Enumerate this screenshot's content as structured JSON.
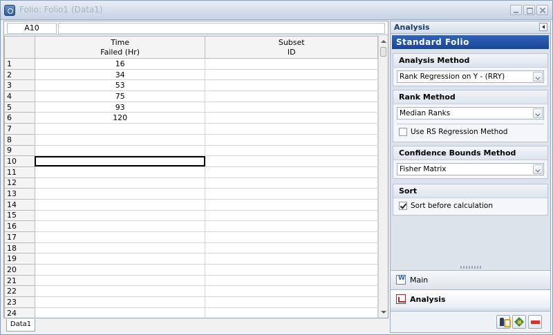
{
  "window": {
    "title": "Folio: Folio1 (Data1)"
  },
  "sheet": {
    "cell_ref": "A10",
    "formula_value": "",
    "columns": [
      {
        "label_line1": "Time",
        "label_line2": "Failed (Hr)"
      },
      {
        "label_line1": "Subset",
        "label_line2": "ID"
      }
    ],
    "rows": [
      {
        "num": "1",
        "time": "16",
        "subset": ""
      },
      {
        "num": "2",
        "time": "34",
        "subset": ""
      },
      {
        "num": "3",
        "time": "53",
        "subset": ""
      },
      {
        "num": "4",
        "time": "75",
        "subset": ""
      },
      {
        "num": "5",
        "time": "93",
        "subset": ""
      },
      {
        "num": "6",
        "time": "120",
        "subset": ""
      },
      {
        "num": "7",
        "time": "",
        "subset": ""
      },
      {
        "num": "8",
        "time": "",
        "subset": ""
      },
      {
        "num": "9",
        "time": "",
        "subset": ""
      },
      {
        "num": "10",
        "time": "",
        "subset": ""
      },
      {
        "num": "11",
        "time": "",
        "subset": ""
      },
      {
        "num": "12",
        "time": "",
        "subset": ""
      },
      {
        "num": "13",
        "time": "",
        "subset": ""
      },
      {
        "num": "14",
        "time": "",
        "subset": ""
      },
      {
        "num": "15",
        "time": "",
        "subset": ""
      },
      {
        "num": "16",
        "time": "",
        "subset": ""
      },
      {
        "num": "17",
        "time": "",
        "subset": ""
      },
      {
        "num": "18",
        "time": "",
        "subset": ""
      },
      {
        "num": "19",
        "time": "",
        "subset": ""
      },
      {
        "num": "20",
        "time": "",
        "subset": ""
      },
      {
        "num": "21",
        "time": "",
        "subset": ""
      },
      {
        "num": "22",
        "time": "",
        "subset": ""
      },
      {
        "num": "23",
        "time": "",
        "subset": ""
      },
      {
        "num": "24",
        "time": "",
        "subset": ""
      }
    ],
    "selected_row": "10",
    "tab": "Data1"
  },
  "panel": {
    "title": "Analysis",
    "banner": "Standard Folio",
    "analysis_method": {
      "title": "Analysis Method",
      "value": "Rank Regression on Y - (RRY)"
    },
    "rank_method": {
      "title": "Rank Method",
      "value": "Median Ranks",
      "rs_regression_label": "Use RS Regression Method",
      "rs_regression_checked": false
    },
    "confidence_bounds": {
      "title": "Confidence Bounds Method",
      "value": "Fisher Matrix"
    },
    "sort": {
      "title": "Sort",
      "label": "Sort before calculation",
      "checked": true
    },
    "nav": {
      "main": "Main",
      "analysis": "Analysis"
    }
  }
}
